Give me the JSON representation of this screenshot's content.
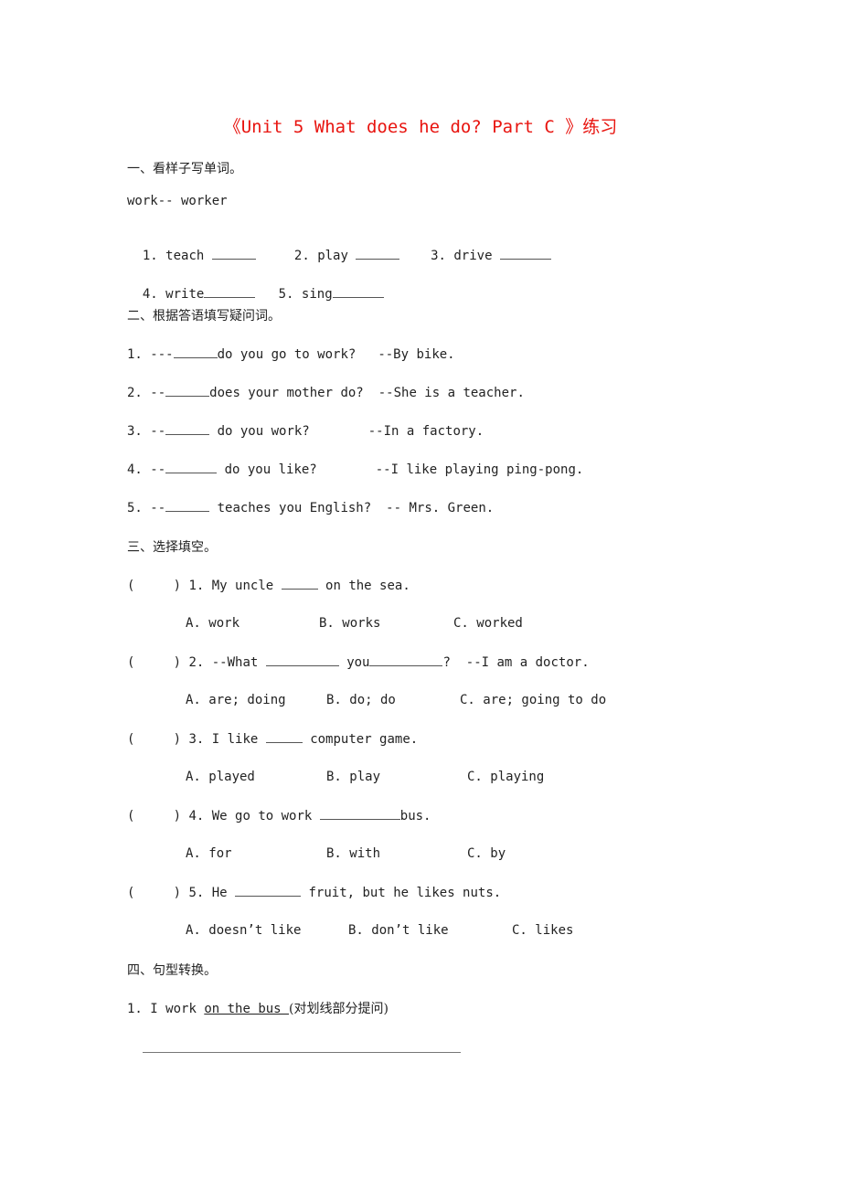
{
  "title": "《Unit 5 What does he do? Part C 》练习",
  "section1": {
    "heading": "一、看样子写单词。",
    "example": "work-- worker",
    "items": [
      {
        "num": "1.",
        "word": "teach"
      },
      {
        "num": "2.",
        "word": "play"
      },
      {
        "num": "3.",
        "word": "drive"
      },
      {
        "num": "4.",
        "word": "write"
      },
      {
        "num": "5.",
        "word": "sing"
      }
    ]
  },
  "section2": {
    "heading": "二、根据答语填写疑问词。",
    "items": [
      {
        "num": "1.",
        "prefix": "---",
        "question": "do you go to work?",
        "answer": "--By bike."
      },
      {
        "num": "2.",
        "prefix": "--",
        "question": "does your mother do?",
        "answer": "--She is a teacher."
      },
      {
        "num": "3.",
        "prefix": "--",
        "question": " do you work?",
        "answer": "--In a factory."
      },
      {
        "num": "4.",
        "prefix": "--",
        "question": " do you like?",
        "answer": "--I like playing ping-pong."
      },
      {
        "num": "5.",
        "prefix": "--",
        "question": " teaches you English?",
        "answer": "-- Mrs. Green."
      }
    ]
  },
  "section3": {
    "heading": "三、选择填空。",
    "items": [
      {
        "num": "1.",
        "before": "My uncle ",
        "after": " on the sea.",
        "options": [
          "A. work",
          "B. works",
          "C. worked"
        ]
      },
      {
        "num": "2.",
        "before": "--What ",
        "mid": " you",
        "after": "?  --I am a doctor.",
        "options": [
          "A. are; doing",
          "B. do; do",
          "C. are; going to do"
        ]
      },
      {
        "num": "3.",
        "before": "I like ",
        "after": " computer game.",
        "options": [
          "A. played",
          "B. play",
          "C. playing"
        ]
      },
      {
        "num": "4.",
        "before": "We go to work ",
        "after": "bus.",
        "options": [
          "A. for",
          "B. with",
          "C. by"
        ]
      },
      {
        "num": "5.",
        "before": "He ",
        "after": " fruit, but he likes nuts.",
        "options": [
          "A. doesn’t like",
          "B. don’t like",
          "C. likes"
        ]
      }
    ]
  },
  "section4": {
    "heading": "四、句型转换。",
    "items": [
      {
        "num": "1.",
        "before": "I work ",
        "underlined": "on the bus ",
        "note": "(对划线部分提问)"
      }
    ]
  },
  "colors": {
    "title": "#e8140f",
    "text": "#222222"
  }
}
